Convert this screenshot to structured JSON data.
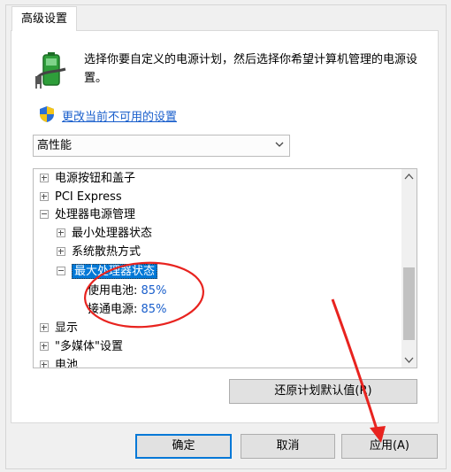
{
  "tab": {
    "label": "高级设置"
  },
  "description": "选择你要自定义的电源计划，然后选择你希望计算机管理的电源设置。",
  "settings_link": "更改当前不可用的设置",
  "plan_select": {
    "value": "高性能"
  },
  "tree": [
    {
      "label": "电源按钮和盖子",
      "expander": "plus"
    },
    {
      "label": "PCI Express",
      "expander": "plus"
    },
    {
      "label": "处理器电源管理",
      "expander": "minus"
    },
    {
      "label": "最小处理器状态",
      "expander": "plus"
    },
    {
      "label": "系统散热方式",
      "expander": "plus"
    },
    {
      "label": "最大处理器状态",
      "expander": "minus",
      "selected": true
    },
    {
      "label": "使用电池:",
      "value": "85%"
    },
    {
      "label": "接通电源:",
      "value": "85%"
    },
    {
      "label": "显示",
      "expander": "plus"
    },
    {
      "label": "\"多媒体\"设置",
      "expander": "plus"
    },
    {
      "label": "电池",
      "expander": "plus"
    }
  ],
  "buttons": {
    "restore": "还原计划默认值(R)",
    "ok": "确定",
    "cancel": "取消",
    "apply": "应用(A)"
  },
  "colors": {
    "annotation": "#e8231f",
    "link": "#1a5fcc",
    "selection": "#0078d7"
  }
}
